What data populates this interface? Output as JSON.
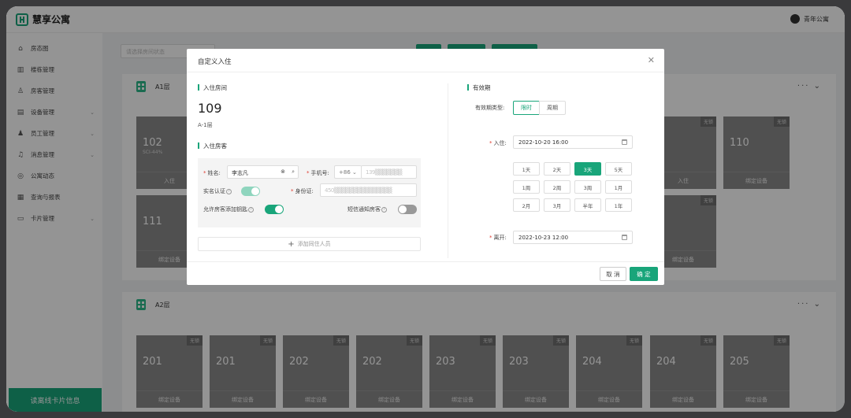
{
  "app": {
    "name": "慧享公寓"
  },
  "user": {
    "name": "青年公寓"
  },
  "sidebar": {
    "items": [
      {
        "label": "房态图",
        "icon": "home-icon",
        "has_children": false
      },
      {
        "label": "楼栋管理",
        "icon": "building-icon",
        "has_children": false
      },
      {
        "label": "房客管理",
        "icon": "user-icon",
        "has_children": false
      },
      {
        "label": "设备管理",
        "icon": "device-icon",
        "has_children": true
      },
      {
        "label": "员工管理",
        "icon": "staff-icon",
        "has_children": true
      },
      {
        "label": "消息管理",
        "icon": "bell-icon",
        "has_children": true
      },
      {
        "label": "公寓动态",
        "icon": "compass-icon",
        "has_children": false
      },
      {
        "label": "查询与报表",
        "icon": "report-icon",
        "has_children": false
      },
      {
        "label": "卡片管理",
        "icon": "card-icon",
        "has_children": true
      }
    ],
    "footer": "读离线卡片信息"
  },
  "main": {
    "search_placeholder": "请选择房间状态",
    "floors": [
      {
        "name": "A1层",
        "rooms": [
          {
            "num": "102",
            "sub": "SCI-44%",
            "tag": "",
            "foot": "入住"
          },
          {
            "num": "111",
            "sub": "",
            "tag": "无锁",
            "foot": "绑定设备"
          },
          {
            "num": "",
            "sub": "",
            "tag": "无锁",
            "foot": "入住"
          },
          {
            "num": "",
            "sub": "",
            "tag": "无锁",
            "foot": "绑定设备"
          },
          {
            "num": "110",
            "sub": "",
            "tag": "无锁",
            "foot": "绑定设备"
          }
        ]
      },
      {
        "name": "A2层",
        "rooms": [
          {
            "num": "201",
            "tag": "无锁",
            "foot": "绑定设备"
          },
          {
            "num": "201",
            "tag": "无锁",
            "foot": "绑定设备"
          },
          {
            "num": "202",
            "tag": "无锁",
            "foot": "绑定设备"
          },
          {
            "num": "202",
            "tag": "无锁",
            "foot": "绑定设备"
          },
          {
            "num": "203",
            "tag": "无锁",
            "foot": "绑定设备"
          },
          {
            "num": "203",
            "tag": "无锁",
            "foot": "绑定设备"
          },
          {
            "num": "204",
            "tag": "无锁",
            "foot": "绑定设备"
          },
          {
            "num": "204",
            "tag": "无锁",
            "foot": "绑定设备"
          },
          {
            "num": "205",
            "tag": "无锁",
            "foot": "绑定设备"
          }
        ]
      }
    ]
  },
  "modal": {
    "title": "自定义入住",
    "room_section": "入住房间",
    "room_number": "109",
    "room_floor": "A-1层",
    "guest_section": "入住房客",
    "name_label": "姓名:",
    "name_value": "李志凡",
    "phone_label": "手机号:",
    "phone_prefix": "+86",
    "phone_value": "139▒▒▒▒▒▒▒",
    "realname_label": "实名认证",
    "idcard_label": "身份证:",
    "idcard_value": "450▒▒▒▒▒▒▒▒▒▒▒▒▒▒▒",
    "allow_key_label": "允许房客添加钥匙",
    "sms_label": "短信通知房客",
    "add_person": "添加同住人员",
    "validity_section": "有效期",
    "validity_type_label": "有效期类型:",
    "validity_types": [
      "限时",
      "周期"
    ],
    "checkin_label": "入住:",
    "checkin_value": "2022-10-20 16:00",
    "durations": [
      "1天",
      "2天",
      "3天",
      "5天",
      "1周",
      "2周",
      "3周",
      "1月",
      "2月",
      "3月",
      "半年",
      "1年"
    ],
    "duration_selected": "3天",
    "checkout_label": "离开:",
    "checkout_value": "2022-10-23 12:00",
    "cancel": "取 消",
    "ok": "确 定"
  },
  "colors": {
    "accent": "#19a57a"
  }
}
